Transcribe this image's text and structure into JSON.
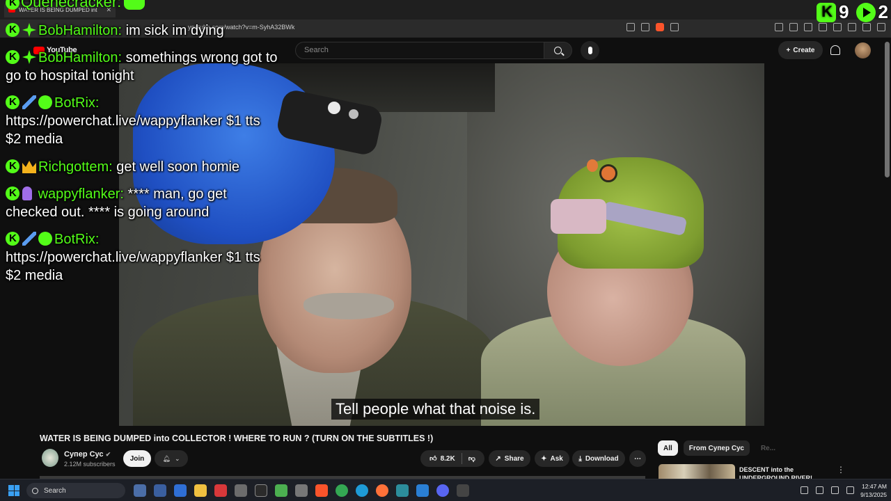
{
  "browser": {
    "tab_title": "WATER IS BEING DUMPED int",
    "url": "youtube.com/watch?v=m-SyhA32BWk"
  },
  "youtube": {
    "logo_text": "YouTube",
    "search_placeholder": "Search",
    "create_label": "Create"
  },
  "video": {
    "subtitle": "Tell people what that noise is.",
    "title": "WATER IS BEING DUMPED into COLLECTOR ! WHERE TO RUN ? (TURN ON THE SUBTITLES !)",
    "channel_name": "Супер Сус",
    "subscribers": "2.12M subscribers",
    "join_label": "Join",
    "likes": "8.2K",
    "share_label": "Share",
    "ask_label": "Ask",
    "download_label": "Download"
  },
  "chat_overlay": {
    "top_partial_name": "Quenecracker:",
    "viewer_count_kick": "9",
    "viewer_count_other": "2",
    "messages": [
      {
        "user": "BobHamilton:",
        "text": "im sick im dying"
      },
      {
        "user": "BobHamilton:",
        "text": "somethings wrong got to go to hospital tonight"
      },
      {
        "user": "BotRix:",
        "text": "https://powerchat.live/wappyflanker $1 tts $2 media"
      },
      {
        "user": "Richgottem:",
        "text": "get well soon homie"
      },
      {
        "user": "wappyflanker:",
        "text": "**** man, go get checked out. **** is going around"
      },
      {
        "user": "BotRix:",
        "text": "https://powerchat.live/wappyflanker $1 tts $2 media"
      }
    ]
  },
  "sidebar": {
    "chips": [
      "All",
      "From Супер Сус",
      "Re..."
    ],
    "recommendation_title": "DESCENT into the UNDERGROUND RIVER! SUPE..."
  },
  "taskbar": {
    "search_label": "Search",
    "time": "12:47 AM",
    "date": "9/13/2025"
  },
  "colors": {
    "kick_green": "#53fc18",
    "youtube_red": "#ff0000",
    "background": "#0f0f0f"
  }
}
